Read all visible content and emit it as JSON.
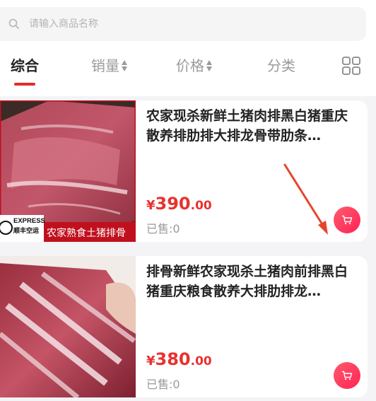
{
  "search": {
    "placeholder": "请输入商品名称"
  },
  "tabs": {
    "comprehensive": "综合",
    "sales": "销量",
    "price": "价格",
    "category": "分类"
  },
  "products": [
    {
      "title": "农家现杀新鲜土猪肉排黑白猪重庆散养排肋排大排龙骨带肋条…",
      "currency": "¥",
      "price_int": "390",
      "price_dec": ".00",
      "sold": "已售:0",
      "badge_brand": "EXPRESS",
      "badge_service": "顺丰空运",
      "badge_caption": "农家熟食土猪排骨"
    },
    {
      "title": "排骨新鲜农家现杀土猪肉前排黑白猪重庆粮食散养大排肋排龙…",
      "currency": "¥",
      "price_int": "380",
      "price_dec": ".00",
      "sold": "已售:0"
    }
  ],
  "colors": {
    "accent": "#e52a2a",
    "price": "#e8322f",
    "cart": "#ff2f5c",
    "arrow": "#e8442c"
  }
}
